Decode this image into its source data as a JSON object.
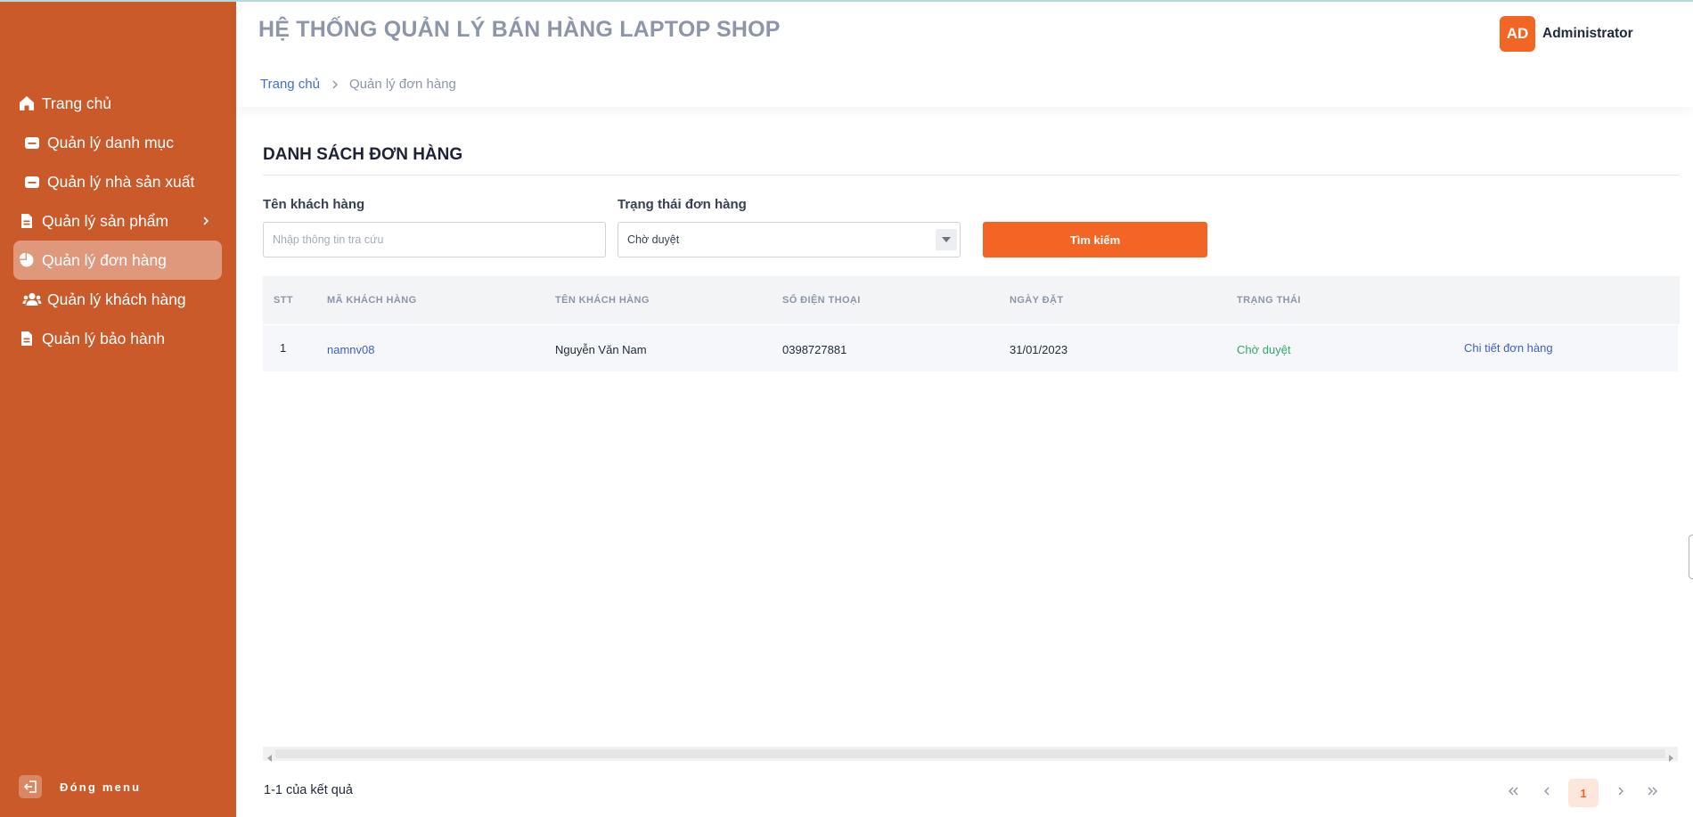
{
  "app": {
    "title": "HỆ THỐNG QUẢN LÝ BÁN HÀNG LAPTOP SHOP",
    "accent_color": "#f26524",
    "sidebar_color": "#cb5a2a"
  },
  "user": {
    "initials": "AD",
    "name": "Administrator"
  },
  "breadcrumb": {
    "home": "Trang chủ",
    "current": "Quản lý đơn hàng"
  },
  "sidebar": {
    "items": [
      {
        "label": "Trang chủ",
        "icon": "home-icon",
        "active": false
      },
      {
        "label": "Quản lý danh mục",
        "icon": "folder-icon",
        "active": false
      },
      {
        "label": "Quản lý nhà sản xuất",
        "icon": "folder-icon",
        "active": false
      },
      {
        "label": "Quản lý sản phẩm",
        "icon": "document-icon",
        "active": false,
        "has_submenu": true
      },
      {
        "label": "Quản lý đơn hàng",
        "icon": "pie-chart-icon",
        "active": true
      },
      {
        "label": "Quản lý khách hàng",
        "icon": "users-icon",
        "active": false
      },
      {
        "label": "Quản lý bảo hành",
        "icon": "document-icon",
        "active": false
      }
    ],
    "collapse_label": "Đóng menu"
  },
  "page": {
    "section_title": "DANH SÁCH ĐƠN HÀNG"
  },
  "filters": {
    "customer_label": "Tên khách hàng",
    "customer_placeholder": "Nhập thông tin tra cứu",
    "customer_value": "",
    "status_label": "Trạng thái đơn hàng",
    "status_value": "Chờ duyệt",
    "search_button": "Tìm kiếm"
  },
  "table": {
    "columns": [
      "STT",
      "MÃ KHÁCH HÀNG",
      "TÊN KHÁCH HÀNG",
      "SỐ ĐIỆN THOẠI",
      "NGÀY ĐẶT",
      "TRẠNG THÁI"
    ],
    "rows": [
      {
        "stt": "1",
        "customer_code": "namnv08",
        "customer_name": "Nguyễn Văn Nam",
        "phone": "0398727881",
        "order_date": "31/01/2023",
        "status": "Chờ duyệt",
        "action": "Chi tiết đơn hàng"
      }
    ]
  },
  "pagination": {
    "summary": "1-1 của kết quả",
    "current_page": "1"
  }
}
